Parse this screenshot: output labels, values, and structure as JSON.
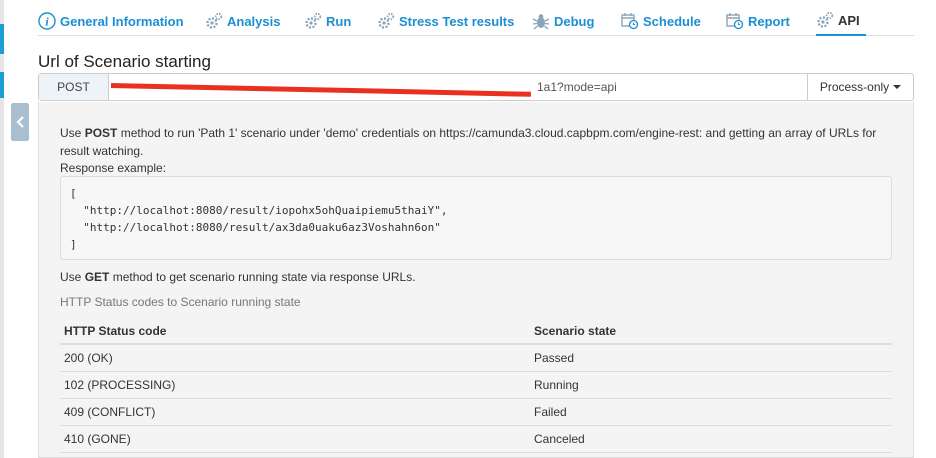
{
  "tabs": [
    {
      "label": "General Information",
      "icon": "info-icon"
    },
    {
      "label": "Analysis",
      "icon": "gears-icon"
    },
    {
      "label": "Run",
      "icon": "gears-icon"
    },
    {
      "label": "Stress Test results",
      "icon": "gears-icon"
    },
    {
      "label": "Debug",
      "icon": "bug-icon"
    },
    {
      "label": "Schedule",
      "icon": "calendar-clock-icon"
    },
    {
      "label": "Report",
      "icon": "calendar-clock-icon"
    },
    {
      "label": "API",
      "icon": "gears-icon"
    }
  ],
  "active_tab": "API",
  "page_title": "Url of Scenario starting",
  "url_row": {
    "method": "POST",
    "url_visible": "1a1?mode=api",
    "mode": "Process-only"
  },
  "description": {
    "part1": "Use ",
    "method": "POST",
    "part2": " method to run 'Path 1' scenario under 'demo' credentials on https://camunda3.cloud.capbpm.com/engine-rest: and getting an array of URLs for result watching."
  },
  "response_label": "Response example:",
  "response_example": "[\n  \"http://localhot:8080/result/iopohx5ohQuaipiemu5thaiY\",\n  \"http://localhot:8080/result/ax3da0uaku6az3Voshahn6on\"\n]",
  "get_description": {
    "part1": "Use ",
    "method": "GET",
    "part2": " method to get scenario running state via response URLs."
  },
  "status_caption": "HTTP Status codes to Scenario running state",
  "status_table": {
    "headers": [
      "HTTP Status code",
      "Scenario state"
    ],
    "rows": [
      [
        "200 (OK)",
        "Passed"
      ],
      [
        "102 (PROCESSING)",
        "Running"
      ],
      [
        "409 (CONFLICT)",
        "Failed"
      ],
      [
        "410 (GONE)",
        "Canceled"
      ]
    ]
  },
  "colors": {
    "accent": "#1b8fd1",
    "redaction": "#e8321f"
  }
}
